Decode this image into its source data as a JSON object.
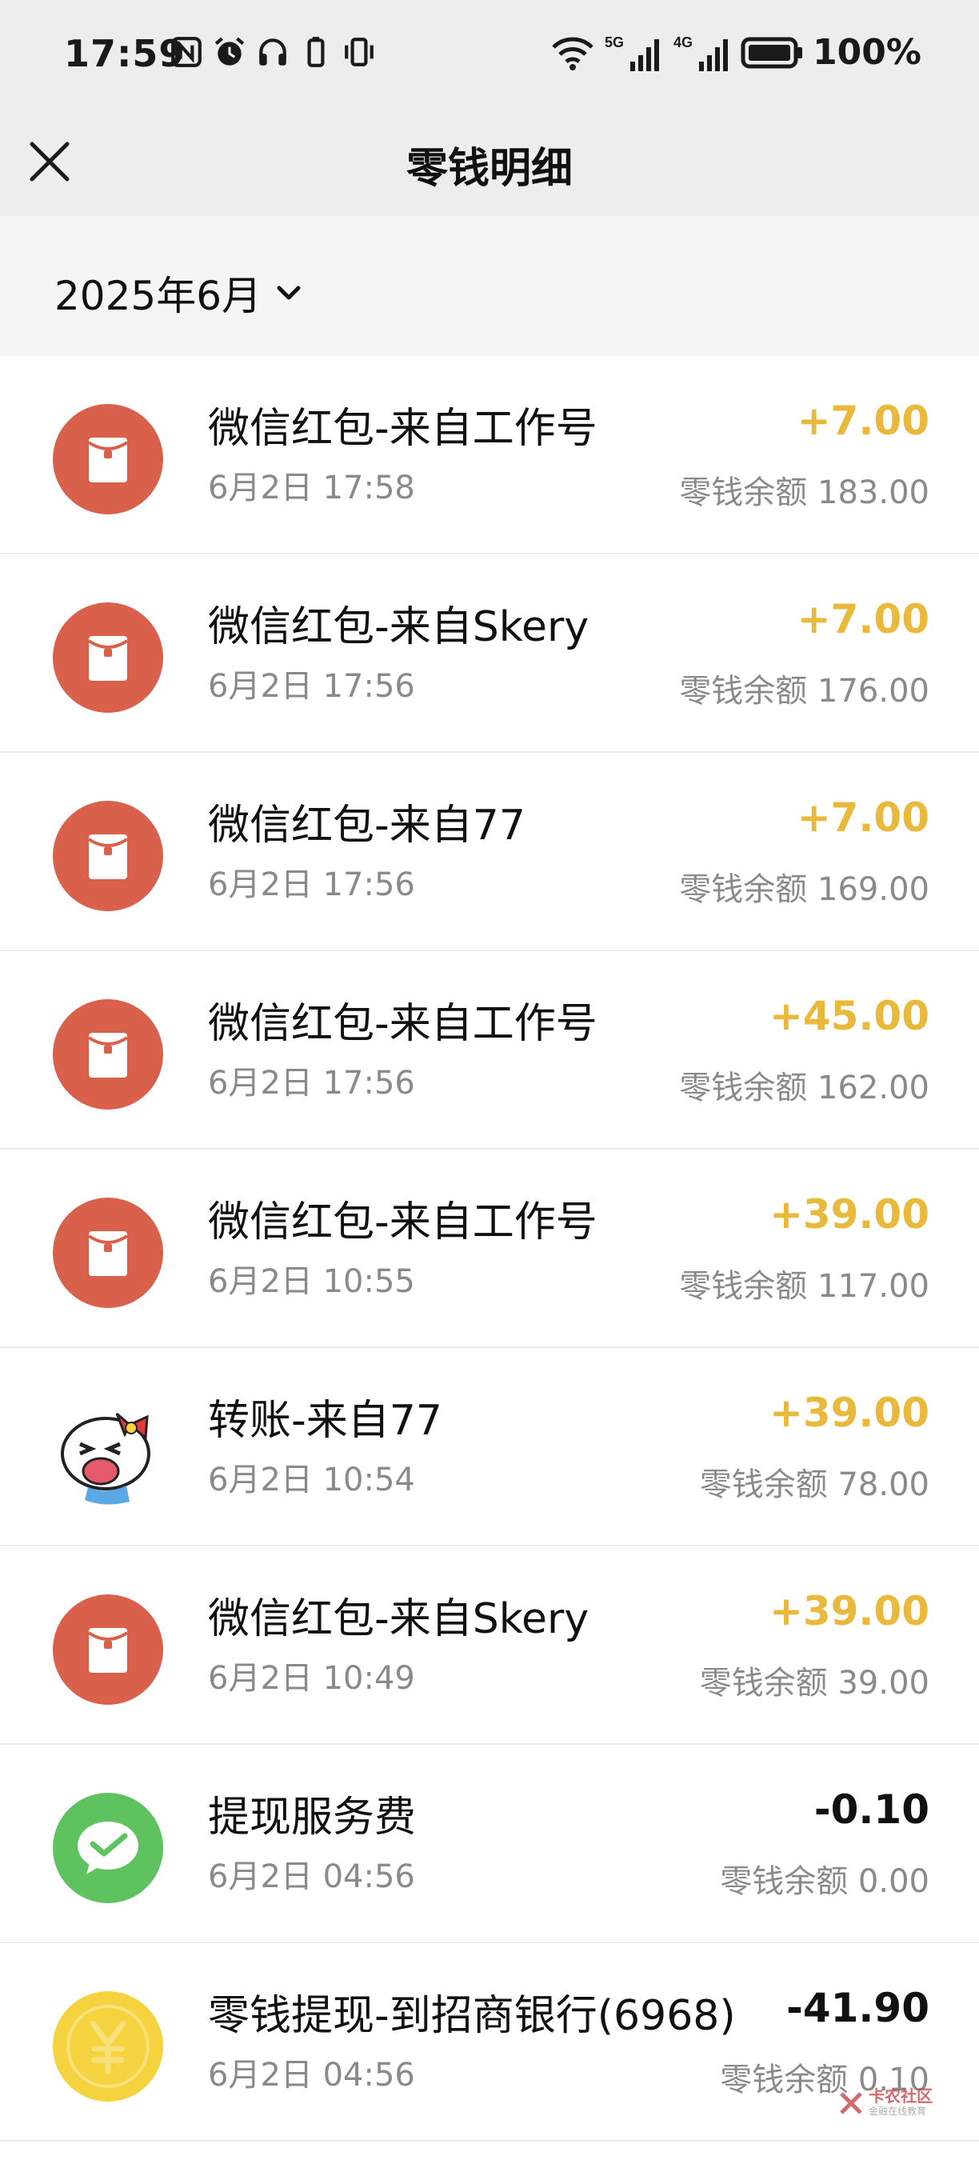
{
  "status_bar": {
    "time": "17:59",
    "battery": "100%",
    "network_5g": "5G",
    "network_4g": "4G"
  },
  "nav": {
    "title": "零钱明细"
  },
  "month_picker": {
    "label": "2025年6月"
  },
  "transactions": [
    {
      "title": "微信红包-来自工作号",
      "time": "6月2日 17:58",
      "amount": "+7.00",
      "balance": "零钱余额 183.00",
      "icon": "red-packet-icon",
      "sign": "pos"
    },
    {
      "title": "微信红包-来自Skery",
      "time": "6月2日 17:56",
      "amount": "+7.00",
      "balance": "零钱余额 176.00",
      "icon": "red-packet-icon",
      "sign": "pos"
    },
    {
      "title": "微信红包-来自77",
      "time": "6月2日 17:56",
      "amount": "+7.00",
      "balance": "零钱余额 169.00",
      "icon": "red-packet-icon",
      "sign": "pos"
    },
    {
      "title": "微信红包-来自工作号",
      "time": "6月2日 17:56",
      "amount": "+45.00",
      "balance": "零钱余额 162.00",
      "icon": "red-packet-icon",
      "sign": "pos"
    },
    {
      "title": "微信红包-来自工作号",
      "time": "6月2日 10:55",
      "amount": "+39.00",
      "balance": "零钱余额 117.00",
      "icon": "red-packet-icon",
      "sign": "pos"
    },
    {
      "title": "转账-来自77",
      "time": "6月2日 10:54",
      "amount": "+39.00",
      "balance": "零钱余额 78.00",
      "icon": "user-avatar-icon",
      "sign": "pos"
    },
    {
      "title": "微信红包-来自Skery",
      "time": "6月2日 10:49",
      "amount": "+39.00",
      "balance": "零钱余额 39.00",
      "icon": "red-packet-icon",
      "sign": "pos"
    },
    {
      "title": "提现服务费",
      "time": "6月2日 04:56",
      "amount": "-0.10",
      "balance": "零钱余额 0.00",
      "icon": "wechat-pay-icon",
      "sign": "neg"
    },
    {
      "title": "零钱提现-到招商银行(6968)",
      "time": "6月2日 04:56",
      "amount": "-41.90",
      "balance": "零钱余额 0.10",
      "icon": "yuan-coin-icon",
      "sign": "neg"
    }
  ],
  "watermark": {
    "text": "卡农社区",
    "sub": "金融在线教育"
  },
  "colors": {
    "positive_amount": "#e8b93a",
    "red_packet": "#d9614c",
    "wechat_green": "#5ec35f",
    "coin_yellow": "#f5d33f",
    "header_bg": "#ededed"
  }
}
